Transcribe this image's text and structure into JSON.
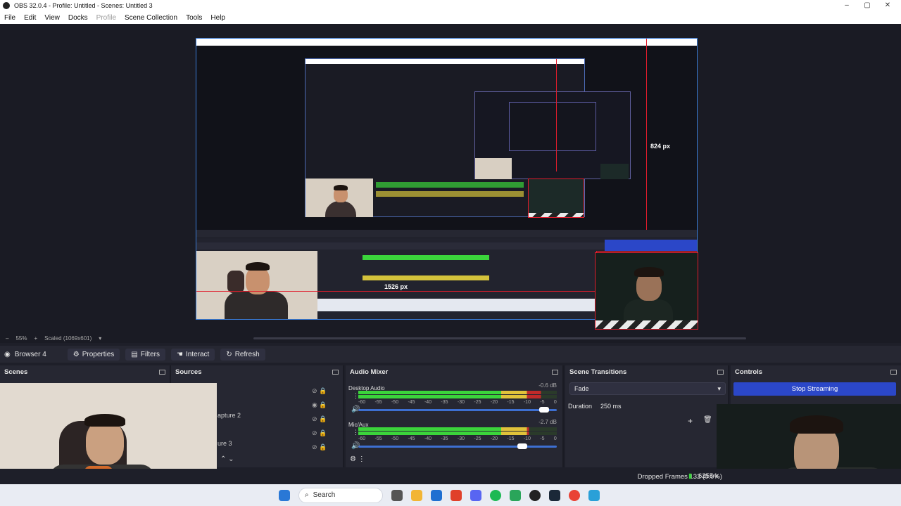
{
  "window": {
    "title": "OBS 32.0.4 - Profile: Untitled - Scenes: Untitled 3",
    "controls": [
      "–",
      "▢",
      "✕"
    ]
  },
  "menu": [
    "File",
    "Edit",
    "View",
    "Docks",
    "Profile",
    "Scene Collection",
    "Tools",
    "Help"
  ],
  "preview": {
    "measure_vertical": "824 px",
    "measure_horizontal": "1526 px",
    "zoom": "55%",
    "scale_mode": "Scaled (1069x601)"
  },
  "source_toolbar": {
    "source_name": "Browser 4",
    "properties": "Properties",
    "filters": "Filters",
    "interact": "Interact",
    "refresh": "Refresh"
  },
  "docks": {
    "scenes": {
      "title": "Scenes"
    },
    "sources": {
      "title": "Sources",
      "items": [
        "apture 2",
        "ure 3"
      ]
    },
    "audio_mixer": {
      "title": "Audio Mixer",
      "channels": [
        {
          "name": "Desktop Audio",
          "db": "-0.6 dB",
          "level": 0.92,
          "volume": 0.96
        },
        {
          "name": "Mic/Aux",
          "db": "-2.7 dB",
          "level": 0.86,
          "volume": 0.85
        }
      ],
      "ticks": [
        "-60",
        "-55",
        "-50",
        "-45",
        "-40",
        "-35",
        "-30",
        "-25",
        "-20",
        "-15",
        "-10",
        "-5",
        "0"
      ]
    },
    "scene_transitions": {
      "title": "Scene Transitions",
      "transition": "Fade",
      "duration_label": "Duration",
      "duration_value": "250 ms"
    },
    "controls": {
      "title": "Controls",
      "stop_streaming": "Stop Streaming"
    }
  },
  "status": {
    "dropped_frames": "Dropped Frames 132 (0.0%)",
    "bitrate": "6255 k"
  },
  "taskbar": {
    "search_placeholder": "Search"
  },
  "colors": {
    "accent": "#2b47c8",
    "guide_red": "#e01c2c",
    "meter_green": "#3bd43b",
    "meter_yellow": "#e0c23a",
    "meter_red": "#c02a2a"
  }
}
